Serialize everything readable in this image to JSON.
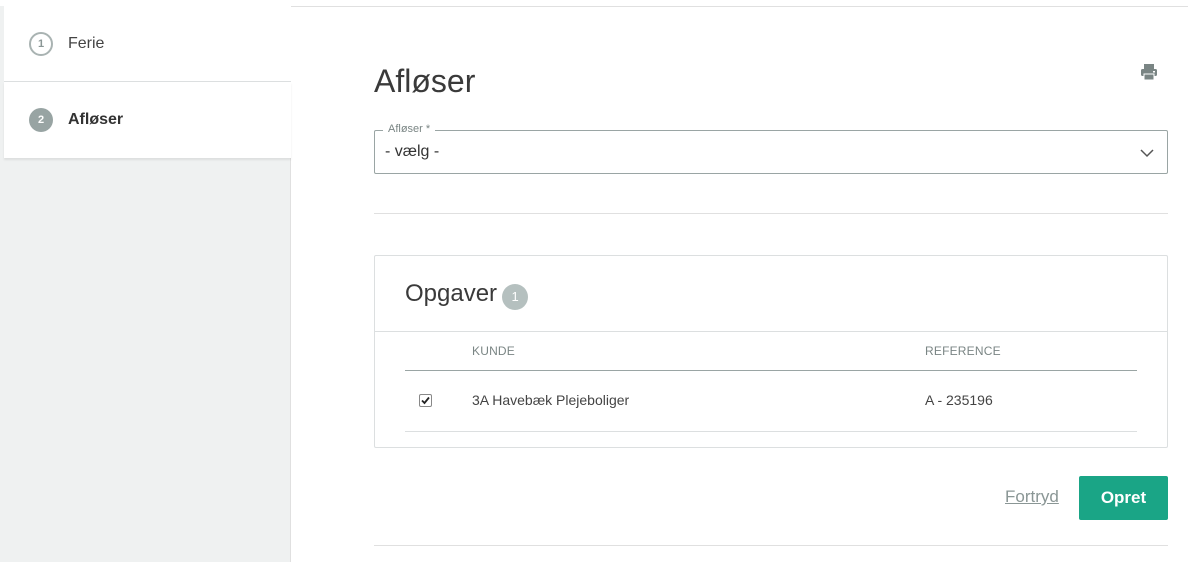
{
  "steps": [
    {
      "number": "1",
      "label": "Ferie"
    },
    {
      "number": "2",
      "label": "Afløser"
    }
  ],
  "page": {
    "title": "Afløser"
  },
  "icons": {
    "print": "print-icon",
    "chevron": "chevron-down-icon",
    "check": "checkmark-icon"
  },
  "afloser_select": {
    "label": "Afløser *",
    "value": "- vælg -"
  },
  "tasks": {
    "title": "Opgaver",
    "count": "1",
    "columns": {
      "kunde": "KUNDE",
      "reference": "REFERENCE"
    },
    "rows": [
      {
        "checked": true,
        "kunde": "3A Havebæk Plejeboliger",
        "reference": "A - 235196"
      }
    ]
  },
  "actions": {
    "cancel_label": "Fortryd",
    "create_label": "Opret"
  },
  "colors": {
    "accent": "#1aa586",
    "sidebar_bg": "#eff1f1",
    "badge": "#b5c0bf"
  }
}
